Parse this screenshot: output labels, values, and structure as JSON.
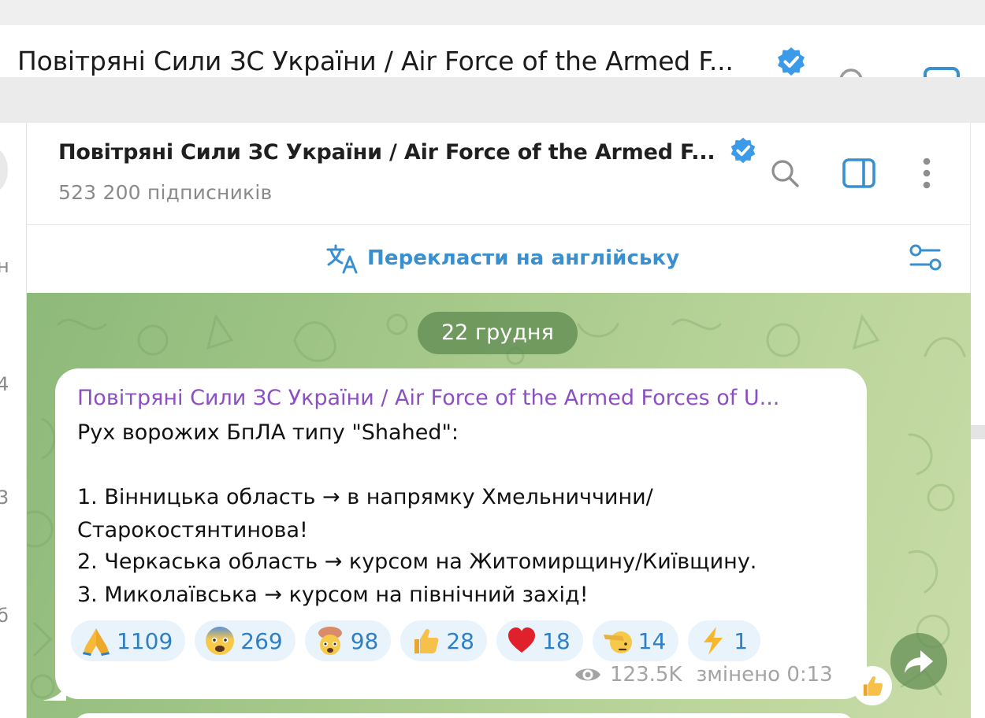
{
  "back_header": {
    "title": "Повітряні Сили ЗС України / Air Force of the Armed F..."
  },
  "left_sliver_chars": [
    "н",
    "4",
    "3",
    "б"
  ],
  "header": {
    "title": "Повітряні Сили ЗС України / Air Force of the Armed F...",
    "subscribers": "523 200 підписників",
    "icons": [
      "verified-icon",
      "search-icon",
      "side-panel-icon",
      "more-icon"
    ]
  },
  "translate": {
    "label": "Перекласти на англійську",
    "icons": [
      "translate-icon",
      "settings-sliders-icon"
    ]
  },
  "date_separator": "22 грудня",
  "message": {
    "sender": "Повітряні Сили ЗС України / Air Force of the Armed Forces of U...",
    "lines": [
      "Рух ворожих БпЛА типу \"Shahed\":",
      "",
      "1. Вінницька область → в напрямку Хмельниччини/",
      "Старокостянтинова!",
      "2. Черкаська область →  курсом на Житомирщину/Київщину.",
      "3. Миколаївська → курсом на північний захід!"
    ],
    "reactions": [
      {
        "icon": "folded-hands-icon",
        "count": "1109"
      },
      {
        "icon": "fearful-face-icon",
        "count": "269"
      },
      {
        "icon": "exploding-head-icon",
        "count": "98"
      },
      {
        "icon": "thumbs-up-icon",
        "count": "28"
      },
      {
        "icon": "red-heart-icon",
        "count": "18"
      },
      {
        "icon": "saluting-face-icon",
        "count": "14"
      },
      {
        "icon": "lightning-icon",
        "count": "1"
      }
    ],
    "views": "123.5K",
    "edited": "змінено 0:13"
  },
  "colors": {
    "accent": "#3a8fcf",
    "sender": "#8b4fc2",
    "reaction_bg": "#e9f3fc",
    "chat_bg": "#a6c98a"
  }
}
